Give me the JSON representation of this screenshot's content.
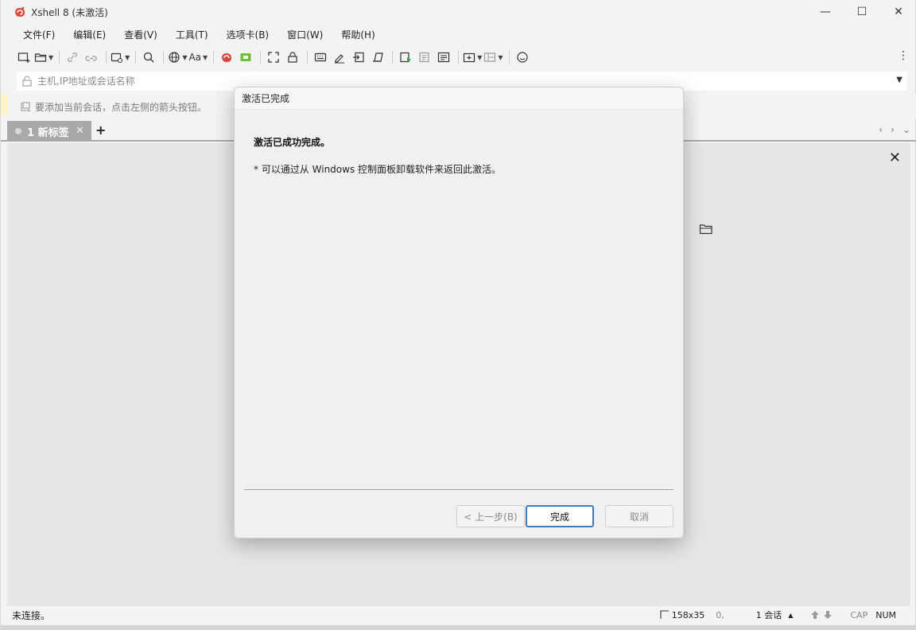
{
  "window": {
    "title": "Xshell 8 (未激活)",
    "minimize_glyph": "—",
    "maximize_glyph": "☐",
    "close_glyph": "✕"
  },
  "menu": [
    "文件(F)",
    "编辑(E)",
    "查看(V)",
    "工具(T)",
    "选项卡(B)",
    "窗口(W)",
    "帮助(H)"
  ],
  "toolbar": {
    "font_label": "Aa",
    "more_glyph": "⋮"
  },
  "address_bar": {
    "placeholder": "主机,IP地址或会话名称",
    "value": ""
  },
  "info_bar": {
    "text": "要添加当前会话，点击左侧的箭头按钮。"
  },
  "tabs": [
    {
      "label": "1 新标签",
      "active": true
    }
  ],
  "tab_controls": {
    "add_glyph": "+",
    "close_glyph": "✕",
    "prev_glyph": "‹",
    "next_glyph": "›",
    "list_glyph": "⌄"
  },
  "session_area": {
    "close_glyph": "✕"
  },
  "status_bar": {
    "left_text": "未连接。",
    "size": "158x35",
    "pos": "0,",
    "sessions": "1 会话",
    "sessions_caret": "▲",
    "up_glyph": "🡅",
    "down_glyph": "🡇",
    "cap": "CAP",
    "num": "NUM"
  },
  "dialog": {
    "title": "激活已完成",
    "heading": "激活已成功完成。",
    "note": "* 可以通过从 Windows 控制面板卸载软件来返回此激活。",
    "buttons": {
      "back": "< 上一步(B)",
      "finish": "完成",
      "cancel": "取消"
    }
  },
  "colors": {
    "accent": "#3a78c8",
    "tab_active_bg": "#a9a9a9",
    "info_stripe": "#fff4c4",
    "logo_red": "#e0453a"
  }
}
